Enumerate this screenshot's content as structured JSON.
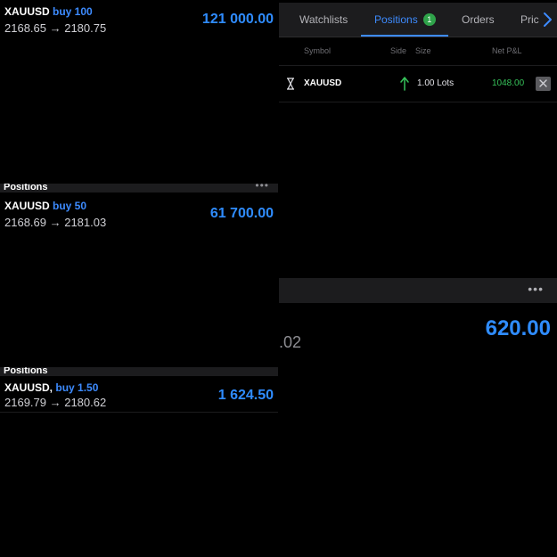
{
  "trades": [
    {
      "symbol": "XAUUSD",
      "side": "buy 100",
      "prices": "2168.65 → 2180.75",
      "profit": "121 000.00"
    },
    {
      "symbol": "XAUUSD",
      "side": "buy 50",
      "prices": "2168.69 → 2181.03",
      "profit": "61 700.00"
    },
    {
      "symbol": "XAUUSD,",
      "side": "buy 1.50",
      "prices": "2169.79 → 2180.62",
      "profit": "1 624.50"
    }
  ],
  "sections": [
    {
      "title": "Positions",
      "more": "•••"
    },
    {
      "title": "Positions"
    }
  ],
  "panel": {
    "tabs": [
      {
        "label": "Watchlists"
      },
      {
        "label": "Positions",
        "badge": "1"
      },
      {
        "label": "Orders"
      },
      {
        "label": "Pric"
      }
    ],
    "columns": {
      "symbol": "Symbol",
      "side": "Side",
      "size": "Size",
      "pnl": "Net P&L"
    },
    "position": {
      "symbol": "XAUUSD",
      "size": "1.00 Lots",
      "pnl": "1048.00",
      "side_icon": "arrow-up-icon"
    }
  },
  "lower_right": {
    "more": "•••",
    "profit": "620.00",
    "fragment": ".02"
  },
  "colors": {
    "accent": "#2f8cff",
    "profit_green": "#36c25a",
    "badge_green": "#2fa34a"
  }
}
